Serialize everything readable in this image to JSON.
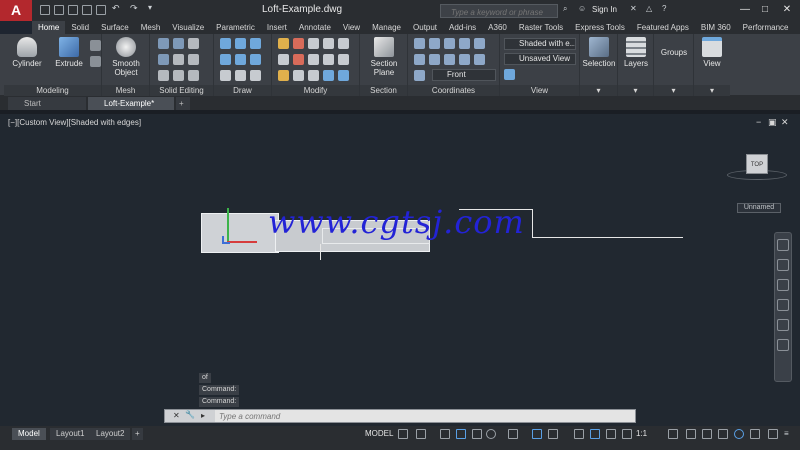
{
  "app": {
    "logo": "A",
    "title": "Loft-Example.dwg"
  },
  "search": {
    "placeholder": "Type a keyword or phrase"
  },
  "account": {
    "signin": "Sign In"
  },
  "window": {
    "minimize": "—",
    "maximize": "□",
    "close": "✕"
  },
  "ribbon_tabs": [
    "Home",
    "Solid",
    "Surface",
    "Mesh",
    "Visualize",
    "Parametric",
    "Insert",
    "Annotate",
    "View",
    "Manage",
    "Output",
    "Add-ins",
    "A360",
    "Raster Tools",
    "Express Tools",
    "Featured Apps",
    "BIM 360",
    "Performance"
  ],
  "panels": {
    "modeling": {
      "label": "Modeling",
      "cylinder": "Cylinder",
      "extrude": "Extrude"
    },
    "mesh": {
      "label": "Mesh",
      "smooth": "Smooth",
      "object": "Object"
    },
    "solid_editing": {
      "label": "Solid Editing"
    },
    "draw": {
      "label": "Draw"
    },
    "modify": {
      "label": "Modify"
    },
    "section": {
      "label": "Section",
      "section": "Section",
      "plane": "Plane"
    },
    "coordinates": {
      "label": "Coordinates",
      "view_select": "Front"
    },
    "view": {
      "label": "View",
      "visual_style": "Shaded with e...",
      "named_view": "Unsaved View"
    },
    "selection": {
      "label": "Selection"
    },
    "layers": {
      "label": "Layers"
    },
    "groups": {
      "label": "Groups"
    },
    "view_btn": {
      "label": "View"
    }
  },
  "file_tabs": {
    "start": "Start",
    "active": "Loft-Example*",
    "add": "+"
  },
  "viewport": {
    "label": "[−][Custom View][Shaded with edges]",
    "controls": {
      "minimize": "−",
      "restore": "▣",
      "close": "✕"
    },
    "viewcube_face": "TOP",
    "ucs_name": "Unnamed"
  },
  "watermark": "www.cgtsj.com",
  "command_history": [
    "of",
    "Command:",
    "Command:"
  ],
  "command_line": {
    "placeholder": "Type a command",
    "close": "✕",
    "settings": "🔧",
    "prompt": "▸"
  },
  "layout_tabs": [
    "Model",
    "Layout1",
    "Layout2"
  ],
  "layout_add": "+",
  "status": {
    "model": "MODEL",
    "scale": "1:1"
  }
}
